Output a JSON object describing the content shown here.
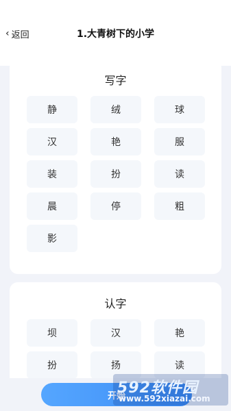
{
  "nav": {
    "back_label": "返回",
    "title": "1.大青树下的小学"
  },
  "sections": [
    {
      "title": "写字",
      "chars": [
        "静",
        "绒",
        "球",
        "汉",
        "艳",
        "服",
        "装",
        "扮",
        "读",
        "晨",
        "停",
        "粗",
        "影"
      ]
    },
    {
      "title": "认字",
      "chars": [
        "坝",
        "汉",
        "艳",
        "扮",
        "扬",
        "读"
      ]
    }
  ],
  "footer": {
    "button_label": "开始"
  },
  "watermark": {
    "line1": "592软件园",
    "line2": "www.592xiazai.com"
  },
  "colors": {
    "accent": "#3c8cf5",
    "background": "#f1f3f9"
  }
}
